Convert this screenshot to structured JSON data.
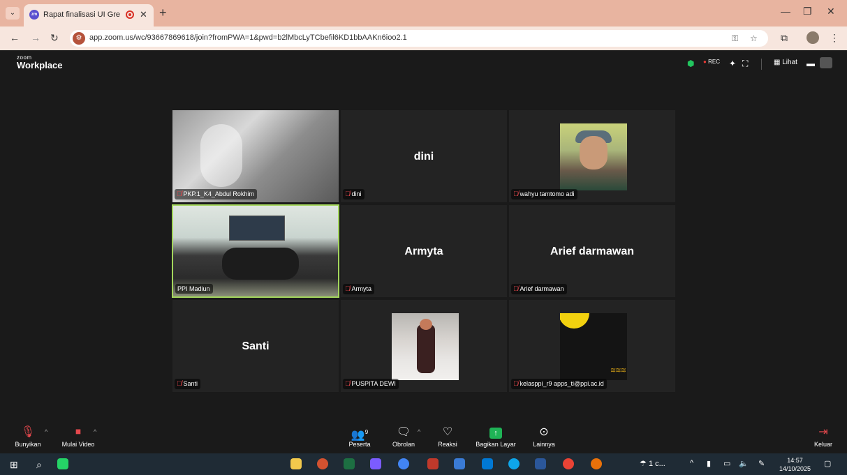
{
  "browser": {
    "tab_title": "Rapat finalisasi UI GreenMe",
    "tab_favicon": "zm",
    "url": "app.zoom.us/wc/93667869618/join?fromPWA=1&pwd=b2lMbcLyTCbefil6KD1bbAAKn6ioo2.1"
  },
  "zoom": {
    "logo_small": "zoom",
    "logo_main": "Workplace",
    "rec_label": "REC",
    "view_label": "Lihat"
  },
  "participants": [
    {
      "name": "PKP.1_K4_Abdul Rokhim",
      "display": "",
      "video": "blur"
    },
    {
      "name": "dini",
      "display": "dini",
      "video": "none"
    },
    {
      "name": "wahyu tamtomo adi",
      "display": "",
      "video": "avatar"
    },
    {
      "name": "PPI Madiun",
      "display": "",
      "video": "room"
    },
    {
      "name": "Armyta",
      "display": "Armyta",
      "video": "none"
    },
    {
      "name": "Arief darmawan",
      "display": "Arief darmawan",
      "video": "none"
    },
    {
      "name": "Santi",
      "display": "Santi",
      "video": "none"
    },
    {
      "name": "PUSPITA DEWI",
      "display": "",
      "video": "avatar"
    },
    {
      "name": "kelasppi_r9 apps_ti@ppi.ac.id",
      "display": "",
      "video": "avatar"
    }
  ],
  "controls": {
    "unmute": "Bunyikan",
    "start_video": "Mulai Video",
    "participants": "Peserta",
    "participants_count": "9",
    "chat": "Obrolan",
    "reactions": "Reaksi",
    "share": "Bagikan Layar",
    "more": "Lainnya",
    "leave": "Keluar"
  },
  "taskbar": {
    "weather": "1 c...",
    "time": "14:57",
    "date": "14/10/2025"
  },
  "colors": {
    "accent_green": "#a3d65c",
    "mic_muted": "#e5484d",
    "share_green": "#1fb356"
  }
}
